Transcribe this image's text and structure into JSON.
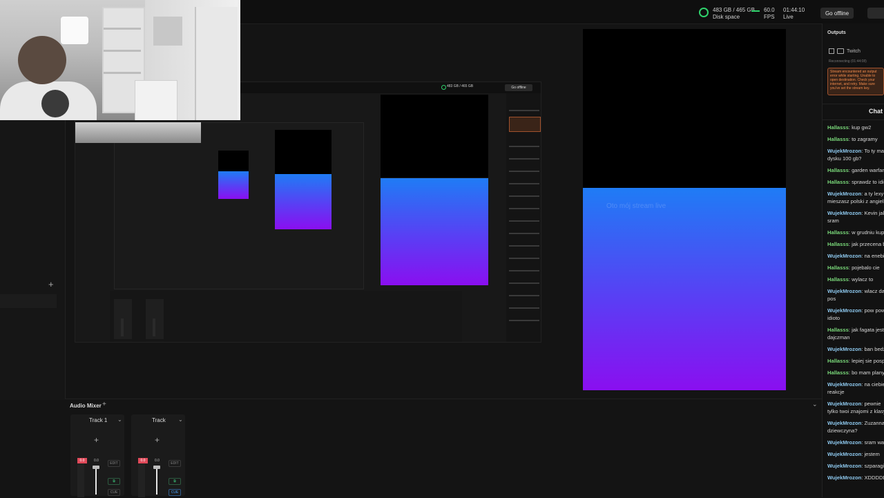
{
  "topbar": {
    "disk_line1": "483 GB / 465 GB",
    "disk_line2": "Disk space",
    "fps_value": "60.0",
    "fps_label": "FPS",
    "time_value": "01:44:10",
    "time_label": "Live",
    "go_offline": "Go offline",
    "accent": "#2fd36c"
  },
  "nested": {
    "stat_line": "483 GB / 465 GB",
    "go_offline": "Go offline"
  },
  "outputs": {
    "title": "Outputs",
    "service": "Twitch",
    "status": "Reconnecting (01:44:08)",
    "error": "Stream encountered an output error while starting. Unable to open destination. Check your internet, and retry. Make sure you've set the stream key."
  },
  "preview": {
    "overlay_text": "Oto mój stream live"
  },
  "chat": {
    "title": "Chat",
    "messages": [
      {
        "user": "Hallasss",
        "text": "kup gw2"
      },
      {
        "user": "Hallasss",
        "text": "to zagramy"
      },
      {
        "user": "WujekMrozon",
        "text": "To ty masz na",
        "cont": "dysku 100 gb?"
      },
      {
        "user": "Hallasss",
        "text": "garden warfare"
      },
      {
        "user": "Hallasss",
        "text": "sprawdz to idioto"
      },
      {
        "user": "WujekMrozon",
        "text": "a ty lexy",
        "cont": "mieszasz polski z angielskim"
      },
      {
        "user": "WujekMrozon",
        "text": "Kevin jak",
        "cont": "sram"
      },
      {
        "user": "Hallasss",
        "text": "w grudniu kupie"
      },
      {
        "user": "Hallasss",
        "text": "jak przecena bedzie"
      },
      {
        "user": "WujekMrozon",
        "text": "na enebie"
      },
      {
        "user": "Hallasss",
        "text": "pojebalo cie"
      },
      {
        "user": "Hallasss",
        "text": "wylacz to"
      },
      {
        "user": "WujekMrozon",
        "text": "wlacz daj",
        "cont": "pos"
      },
      {
        "user": "WujekMrozon",
        "text": "pow pow",
        "cont": "idioto"
      },
      {
        "user": "Hallasss",
        "text": "jak fagata jest",
        "cont": "dajczman"
      },
      {
        "user": "WujekMrozon",
        "text": "ban bedzie"
      },
      {
        "user": "Hallasss",
        "text": "lepiej sie pospiesz"
      },
      {
        "user": "Hallasss",
        "text": "bo mam plany"
      },
      {
        "user": "WujekMrozon",
        "text": "na ciebie",
        "cont": "reakcje"
      },
      {
        "user": "WujekMrozon",
        "text": "pewnie",
        "cont": "tylko twoi znajomi z klasy"
      },
      {
        "user": "WujekMrozon",
        "text": "Zuzanna",
        "cont": "dziewczyna?"
      },
      {
        "user": "WujekMrozon",
        "text": "sram wam"
      },
      {
        "user": "WujekMrozon",
        "text": "jestem"
      },
      {
        "user": "WujekMrozon",
        "text": "szparagi"
      },
      {
        "user": "WujekMrozon",
        "text": "XDDDDD"
      }
    ]
  },
  "mixer": {
    "title": "Audio Mixer",
    "tracks": [
      {
        "name": "Track 1",
        "meter": "0.0",
        "value": "0.0",
        "edit": "EDIT",
        "cue": "CUE"
      },
      {
        "name": "Track",
        "meter": "0.0",
        "value": "0.0",
        "edit": "EDIT",
        "cue": "CUE"
      }
    ]
  }
}
